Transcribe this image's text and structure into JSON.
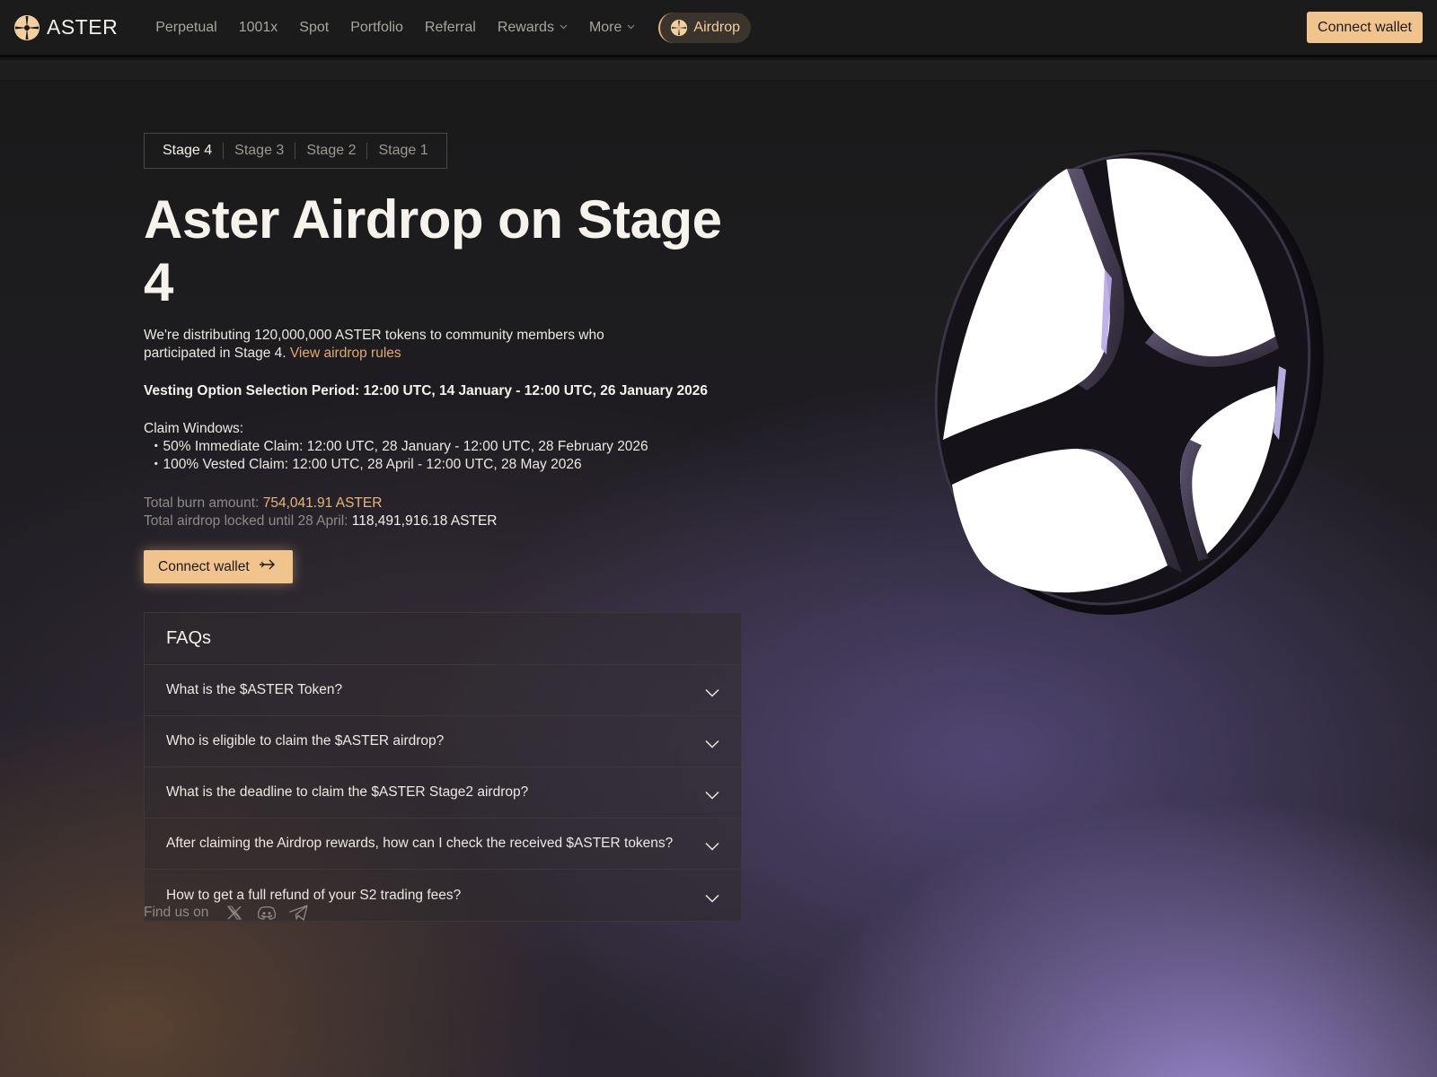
{
  "header": {
    "logo_text": "ASTER",
    "nav": [
      {
        "label": "Perpetual"
      },
      {
        "label": "1001x"
      },
      {
        "label": "Spot"
      },
      {
        "label": "Portfolio"
      },
      {
        "label": "Referral"
      },
      {
        "label": "Rewards"
      },
      {
        "label": "More"
      }
    ],
    "airdrop_label": "Airdrop",
    "connect_label": "Connect wallet"
  },
  "stages": [
    "Stage 4",
    "Stage 3",
    "Stage 2",
    "Stage 1"
  ],
  "main": {
    "title": "Aster Airdrop on Stage 4",
    "description": "We're distributing 120,000,000 ASTER tokens to community members who participated in Stage 4.",
    "rules_link": "View airdrop rules",
    "vesting": "Vesting Option Selection Period: 12:00 UTC, 14 January - 12:00 UTC, 26 January 2026",
    "claim_title": "Claim Windows:",
    "claim_items": [
      "・50% Immediate Claim: 12:00 UTC, 28 January - 12:00 UTC, 28 February 2026",
      "・100% Vested Claim: 12:00 UTC, 28 April - 12:00 UTC, 28 May 2026"
    ],
    "burn_label": "Total burn amount:",
    "burn_value": "754,041.91 ASTER",
    "locked_label": "Total airdrop locked until 28 April:",
    "locked_value": "118,491,916.18 ASTER",
    "cta_label": "Connect wallet"
  },
  "faq": {
    "title": "FAQs",
    "items": [
      "What is the $ASTER Token?",
      "Who is eligible to claim the $ASTER airdrop?",
      "What is the deadline to claim the $ASTER Stage2 airdrop?",
      "After claiming the Airdrop rewards, how can I check the received $ASTER tokens?",
      "How to get a full refund of your S2 trading fees?"
    ]
  },
  "social": {
    "label": "Find us on",
    "icons": [
      "x-icon",
      "discord-icon",
      "telegram-icon"
    ]
  },
  "colors": {
    "accent": "#f2c48d",
    "link": "#e0a96c",
    "header_bg": "#1b1b1b"
  }
}
